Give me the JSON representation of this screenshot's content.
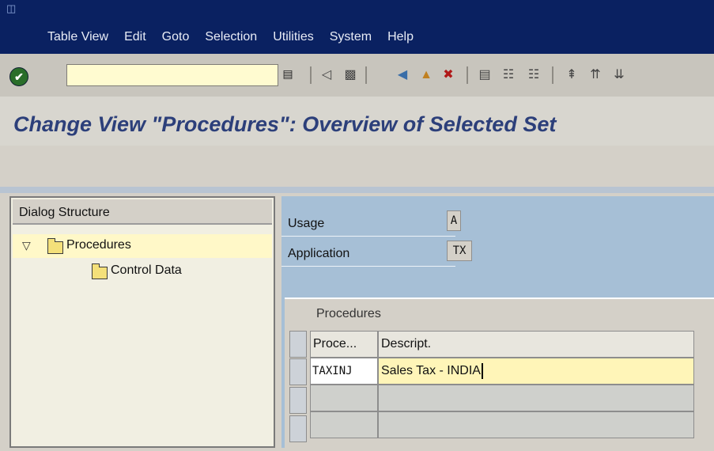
{
  "menubar": {
    "items": [
      {
        "label": "Table View"
      },
      {
        "label": "Edit"
      },
      {
        "label": "Goto"
      },
      {
        "label": "Selection"
      },
      {
        "label": "Utilities"
      },
      {
        "label": "System"
      },
      {
        "label": "Help"
      }
    ]
  },
  "toolbar": {
    "command_value": "",
    "icons": [
      "enter-icon",
      "command-history-icon",
      "back-nav-icon",
      "save-icon",
      "back-icon",
      "exit-icon",
      "cancel-icon",
      "print-icon",
      "find-icon",
      "find-next-icon",
      "first-page-icon",
      "previous-page-icon",
      "next-page-icon"
    ]
  },
  "title": "Change View \"Procedures\": Overview of Selected Set",
  "tree": {
    "header": "Dialog Structure",
    "items": [
      {
        "label": "Procedures",
        "expanded": true,
        "selected": true
      },
      {
        "label": "Control Data"
      }
    ]
  },
  "header_fields": {
    "usage_label": "Usage",
    "usage_value": "A",
    "application_label": "Application",
    "application_value": "TX"
  },
  "table": {
    "title": "Procedures",
    "columns": [
      "Proce...",
      "Descript."
    ],
    "rows": [
      {
        "procedure": "TAXINJ",
        "description": "Sales Tax - INDIA"
      }
    ]
  },
  "colors": {
    "menubar": "#0a2161",
    "title_text": "#2c3f7a",
    "panel_blue": "#a6bfd6",
    "highlight_yellow": "#fff5b8"
  }
}
